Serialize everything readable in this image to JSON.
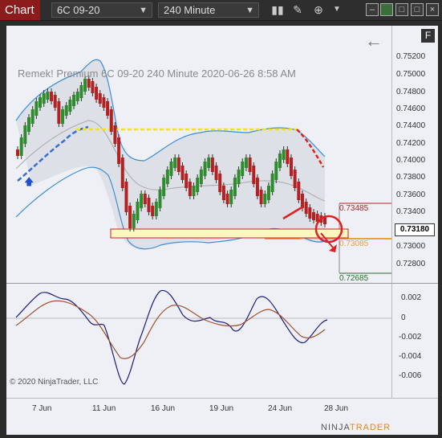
{
  "toolbar": {
    "tab_label": "Chart",
    "instrument": "6C 09-20",
    "interval": "240 Minute",
    "icons": [
      "bar-chart-icon",
      "draw-pencil-icon",
      "zoom-icon",
      "chevron-down-icon"
    ]
  },
  "chart": {
    "title": "Remek!  Premium  6C 09-20  240 Minute  2020-06-26 8:58 AM",
    "copyright": "© 2020 NinjaTrader, LLC",
    "f_badge": "F",
    "current_price": "0.73180",
    "level_upper": "0.73485",
    "level_mid": "0.73085",
    "level_lower": "0.72685",
    "price_ticks": [
      "0.75200",
      "0.75000",
      "0.74800",
      "0.74600",
      "0.74400",
      "0.74200",
      "0.74000",
      "0.73800",
      "0.73600",
      "0.73400",
      "0.73200",
      "0.73000",
      "0.72800"
    ],
    "osc_ticks": [
      "0.002",
      "0",
      "-0.002",
      "-0.004",
      "-0.006"
    ],
    "dates": [
      "7 Jun",
      "11 Jun",
      "16 Jun",
      "19 Jun",
      "24 Jun",
      "28 Jun"
    ],
    "colors": {
      "up": "#2e8b2e",
      "down": "#b22222",
      "band": "#3a8fd8",
      "yellow": "#f5e600",
      "red": "#e02020",
      "navy": "#1c1c7c",
      "brown": "#a0522d"
    }
  },
  "logo": {
    "left": "NINJA",
    "right": "TRADER"
  }
}
